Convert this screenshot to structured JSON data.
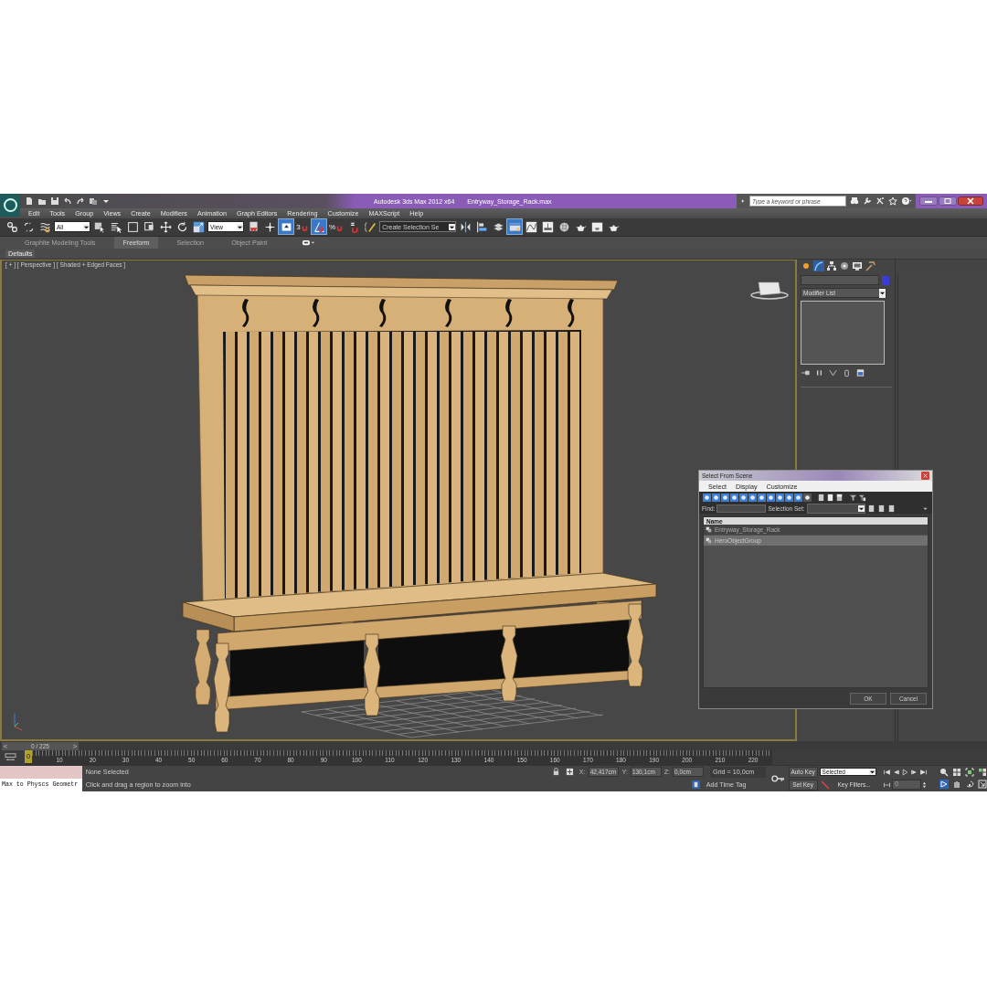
{
  "window": {
    "title": "Autodesk 3ds Max  2012 x64",
    "file": "Entryway_Storage_Rack.max"
  },
  "search": {
    "placeholder": "Type a keyword or phrase"
  },
  "menu": [
    "Edit",
    "Tools",
    "Group",
    "Views",
    "Create",
    "Modifiers",
    "Animation",
    "Graph Editors",
    "Rendering",
    "Customize",
    "MAXScript",
    "Help"
  ],
  "toolbar": [
    {
      "kind": "link",
      "active": false
    },
    {
      "kind": "unlink",
      "active": false
    },
    {
      "kind": "bind",
      "active": false
    },
    {
      "kind": "dropdown",
      "value": "All"
    },
    {
      "kind": "select",
      "active": false
    },
    {
      "kind": "select-by-name",
      "active": false
    },
    {
      "kind": "region",
      "active": false
    },
    {
      "kind": "window-crossing",
      "active": false
    },
    {
      "kind": "move",
      "active": false
    },
    {
      "kind": "rotate",
      "active": false
    },
    {
      "kind": "scale",
      "active": false
    },
    {
      "kind": "dropdown",
      "value": "View"
    },
    {
      "kind": "pivot",
      "active": false
    },
    {
      "kind": "manipulate",
      "active": false
    },
    {
      "kind": "keyboard",
      "active": true
    },
    {
      "kind": "snap",
      "label": "3",
      "active": false
    },
    {
      "kind": "angle-snap",
      "active": true
    },
    {
      "kind": "percent-snap",
      "label": "%",
      "active": false
    },
    {
      "kind": "spinner-snap",
      "active": false
    },
    {
      "kind": "edit-named",
      "active": false
    },
    {
      "kind": "dropdown",
      "value": "Create Selection Se"
    },
    {
      "kind": "mirror",
      "active": false
    },
    {
      "kind": "align",
      "active": false
    },
    {
      "kind": "layers",
      "active": false
    },
    {
      "kind": "ribbon",
      "active": true
    },
    {
      "kind": "curve-editor",
      "active": false
    },
    {
      "kind": "schematic",
      "active": false
    },
    {
      "kind": "material",
      "active": false
    },
    {
      "kind": "render-setup",
      "active": false
    },
    {
      "kind": "rendered-frame",
      "active": false
    },
    {
      "kind": "render",
      "active": false
    }
  ],
  "ribbon_tabs": [
    {
      "label": "Graphite Modeling Tools",
      "selected": false
    },
    {
      "label": "Freeform",
      "selected": true
    },
    {
      "label": "Selection",
      "selected": false
    },
    {
      "label": "Object Paint",
      "selected": false
    }
  ],
  "ribbon_panel": "Defaults",
  "viewport": {
    "label": "[ + ] [ Perspective ] [ Shaded + Edged Faces ]"
  },
  "command_panel": {
    "tabs": [
      {
        "kind": "create",
        "selected": false
      },
      {
        "kind": "modify",
        "selected": true
      },
      {
        "kind": "hierarchy",
        "selected": false
      },
      {
        "kind": "motion",
        "selected": false
      },
      {
        "kind": "display",
        "selected": false
      },
      {
        "kind": "utilities",
        "selected": false
      }
    ],
    "modifier_list": "Modifier List"
  },
  "dialog": {
    "title": "Select From Scene",
    "menu": [
      "Select",
      "Display",
      "Customize"
    ],
    "type_filters": [
      {
        "on": true
      },
      {
        "on": true
      },
      {
        "on": true
      },
      {
        "on": true
      },
      {
        "on": true
      },
      {
        "on": true
      },
      {
        "on": true
      },
      {
        "on": true
      },
      {
        "on": true
      },
      {
        "on": true
      },
      {
        "on": true
      },
      {
        "on": false
      }
    ],
    "find_label": "Find:",
    "selection_set_label": "Selection Set:",
    "column": "Name",
    "rows": [
      {
        "name": "Entryway_Storage_Rack",
        "selected": false
      },
      {
        "name": "HeroObjectGroup",
        "selected": true
      }
    ],
    "buttons": [
      "OK",
      "Cancel"
    ]
  },
  "timeline": {
    "level": 0,
    "frame": "0 / 225",
    "prev": "<",
    "next": ">",
    "current": "0",
    "ticks": [
      "10",
      "20",
      "30",
      "40",
      "50",
      "60",
      "70",
      "80",
      "90",
      "100",
      "110",
      "120",
      "130",
      "140",
      "150",
      "160",
      "170",
      "180",
      "190",
      "200",
      "210",
      "220"
    ]
  },
  "status": {
    "listener": "Max to Physcs Geometr",
    "selection": "None Selected",
    "prompt": "Click and drag a region to zoom into",
    "coordinates": [
      {
        "label": "X:",
        "value": "42,417cm"
      },
      {
        "label": "Y:",
        "value": "130,1cm"
      },
      {
        "label": "Z:",
        "value": "0,0cm"
      }
    ],
    "grid": "Grid = 10,0cm",
    "add_time_tag": "Add Time Tag",
    "auto_key": "Auto Key",
    "key_mode": "Selected",
    "set_key": "Set Key",
    "key_filters": "Key Filters...",
    "frame_field": "0"
  }
}
